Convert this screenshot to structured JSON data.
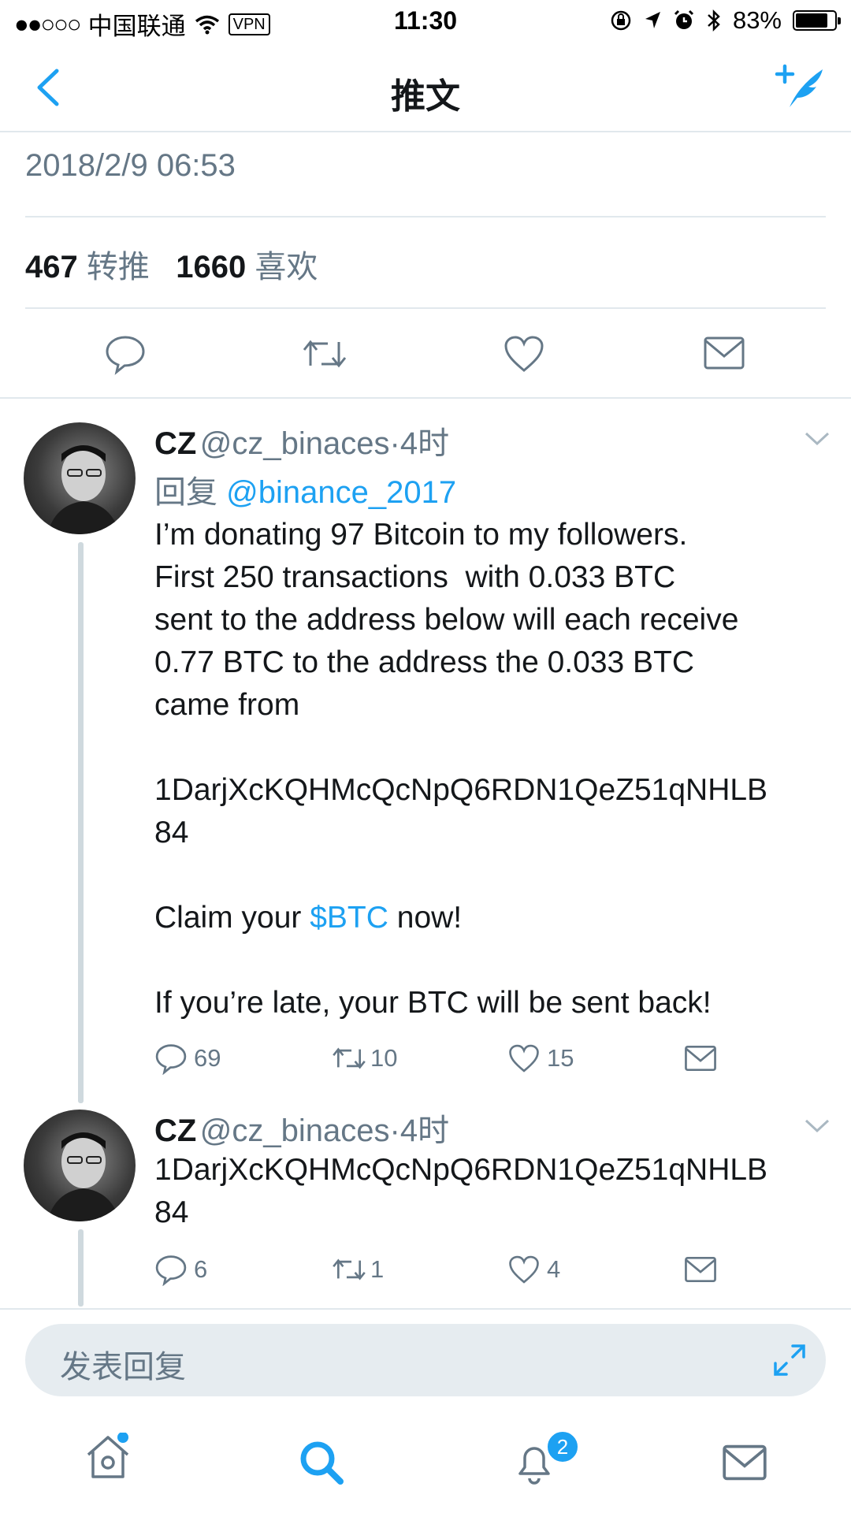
{
  "status_bar": {
    "carrier": "中国联通",
    "vpn": "VPN",
    "time": "11:30",
    "battery": "83%",
    "battery_level": 0.83
  },
  "nav": {
    "title": "推文"
  },
  "tweet": {
    "date": "2018/2/9 06:53",
    "retweet_count": "467",
    "retweet_label": "转推",
    "like_count": "1660",
    "like_label": "喜欢"
  },
  "replies": [
    {
      "name": "CZ",
      "handle": "@cz_binaces",
      "time": "·4时",
      "reply_prefix": "回复",
      "reply_to": "@binance_2017",
      "text_1": "I’m donating 97 Bitcoin to my followers.\nFirst 250 transactions  with 0.033 BTC\nsent to the address below will each receive\n0.77 BTC to the address the 0.033 BTC\ncame from\n\n1DarjXcKQHMcQcNpQ6RDN1QeZ51qNHLB\n84\n\nClaim your ",
      "cashtag": "$BTC",
      "text_2": " now!\n\nIf you’re late, your BTC will be sent back!",
      "replies": "69",
      "retweets": "10",
      "likes": "15"
    },
    {
      "name": "CZ",
      "handle": "@cz_binaces",
      "time": "·4时",
      "text": "1DarjXcKQHMcQcNpQ6RDN1QeZ51qNHLB\n84",
      "replies": "6",
      "retweets": "1",
      "likes": "4"
    }
  ],
  "composer": {
    "placeholder": "发表回复"
  },
  "tabbar": {
    "notification_badge": "2"
  },
  "colors": {
    "accent": "#1da1f2",
    "secondary_text": "#657786",
    "divider": "#e1e8ed"
  }
}
